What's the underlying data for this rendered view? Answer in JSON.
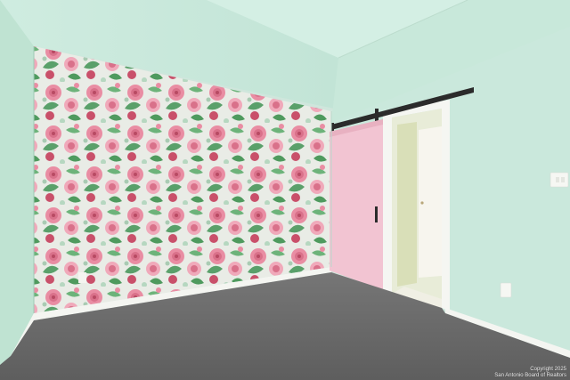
{
  "scene": {
    "description_colors": {
      "left_wall": "#c4e6d6",
      "ceiling": "#d6f0e6",
      "right_wall": "#cde9de",
      "carpet": "#6f6f6f",
      "barn_door": "#f2c4d2",
      "trim": "#f6f7f4",
      "rail": "#2b2b2b",
      "flower_pink": "#e98da3",
      "flower_dark": "#c9506a",
      "leaf_green": "#4f9a5e"
    }
  },
  "watermark": {
    "line1": "Copyright 2025",
    "line2": "San Antonio Board of Realtors"
  }
}
